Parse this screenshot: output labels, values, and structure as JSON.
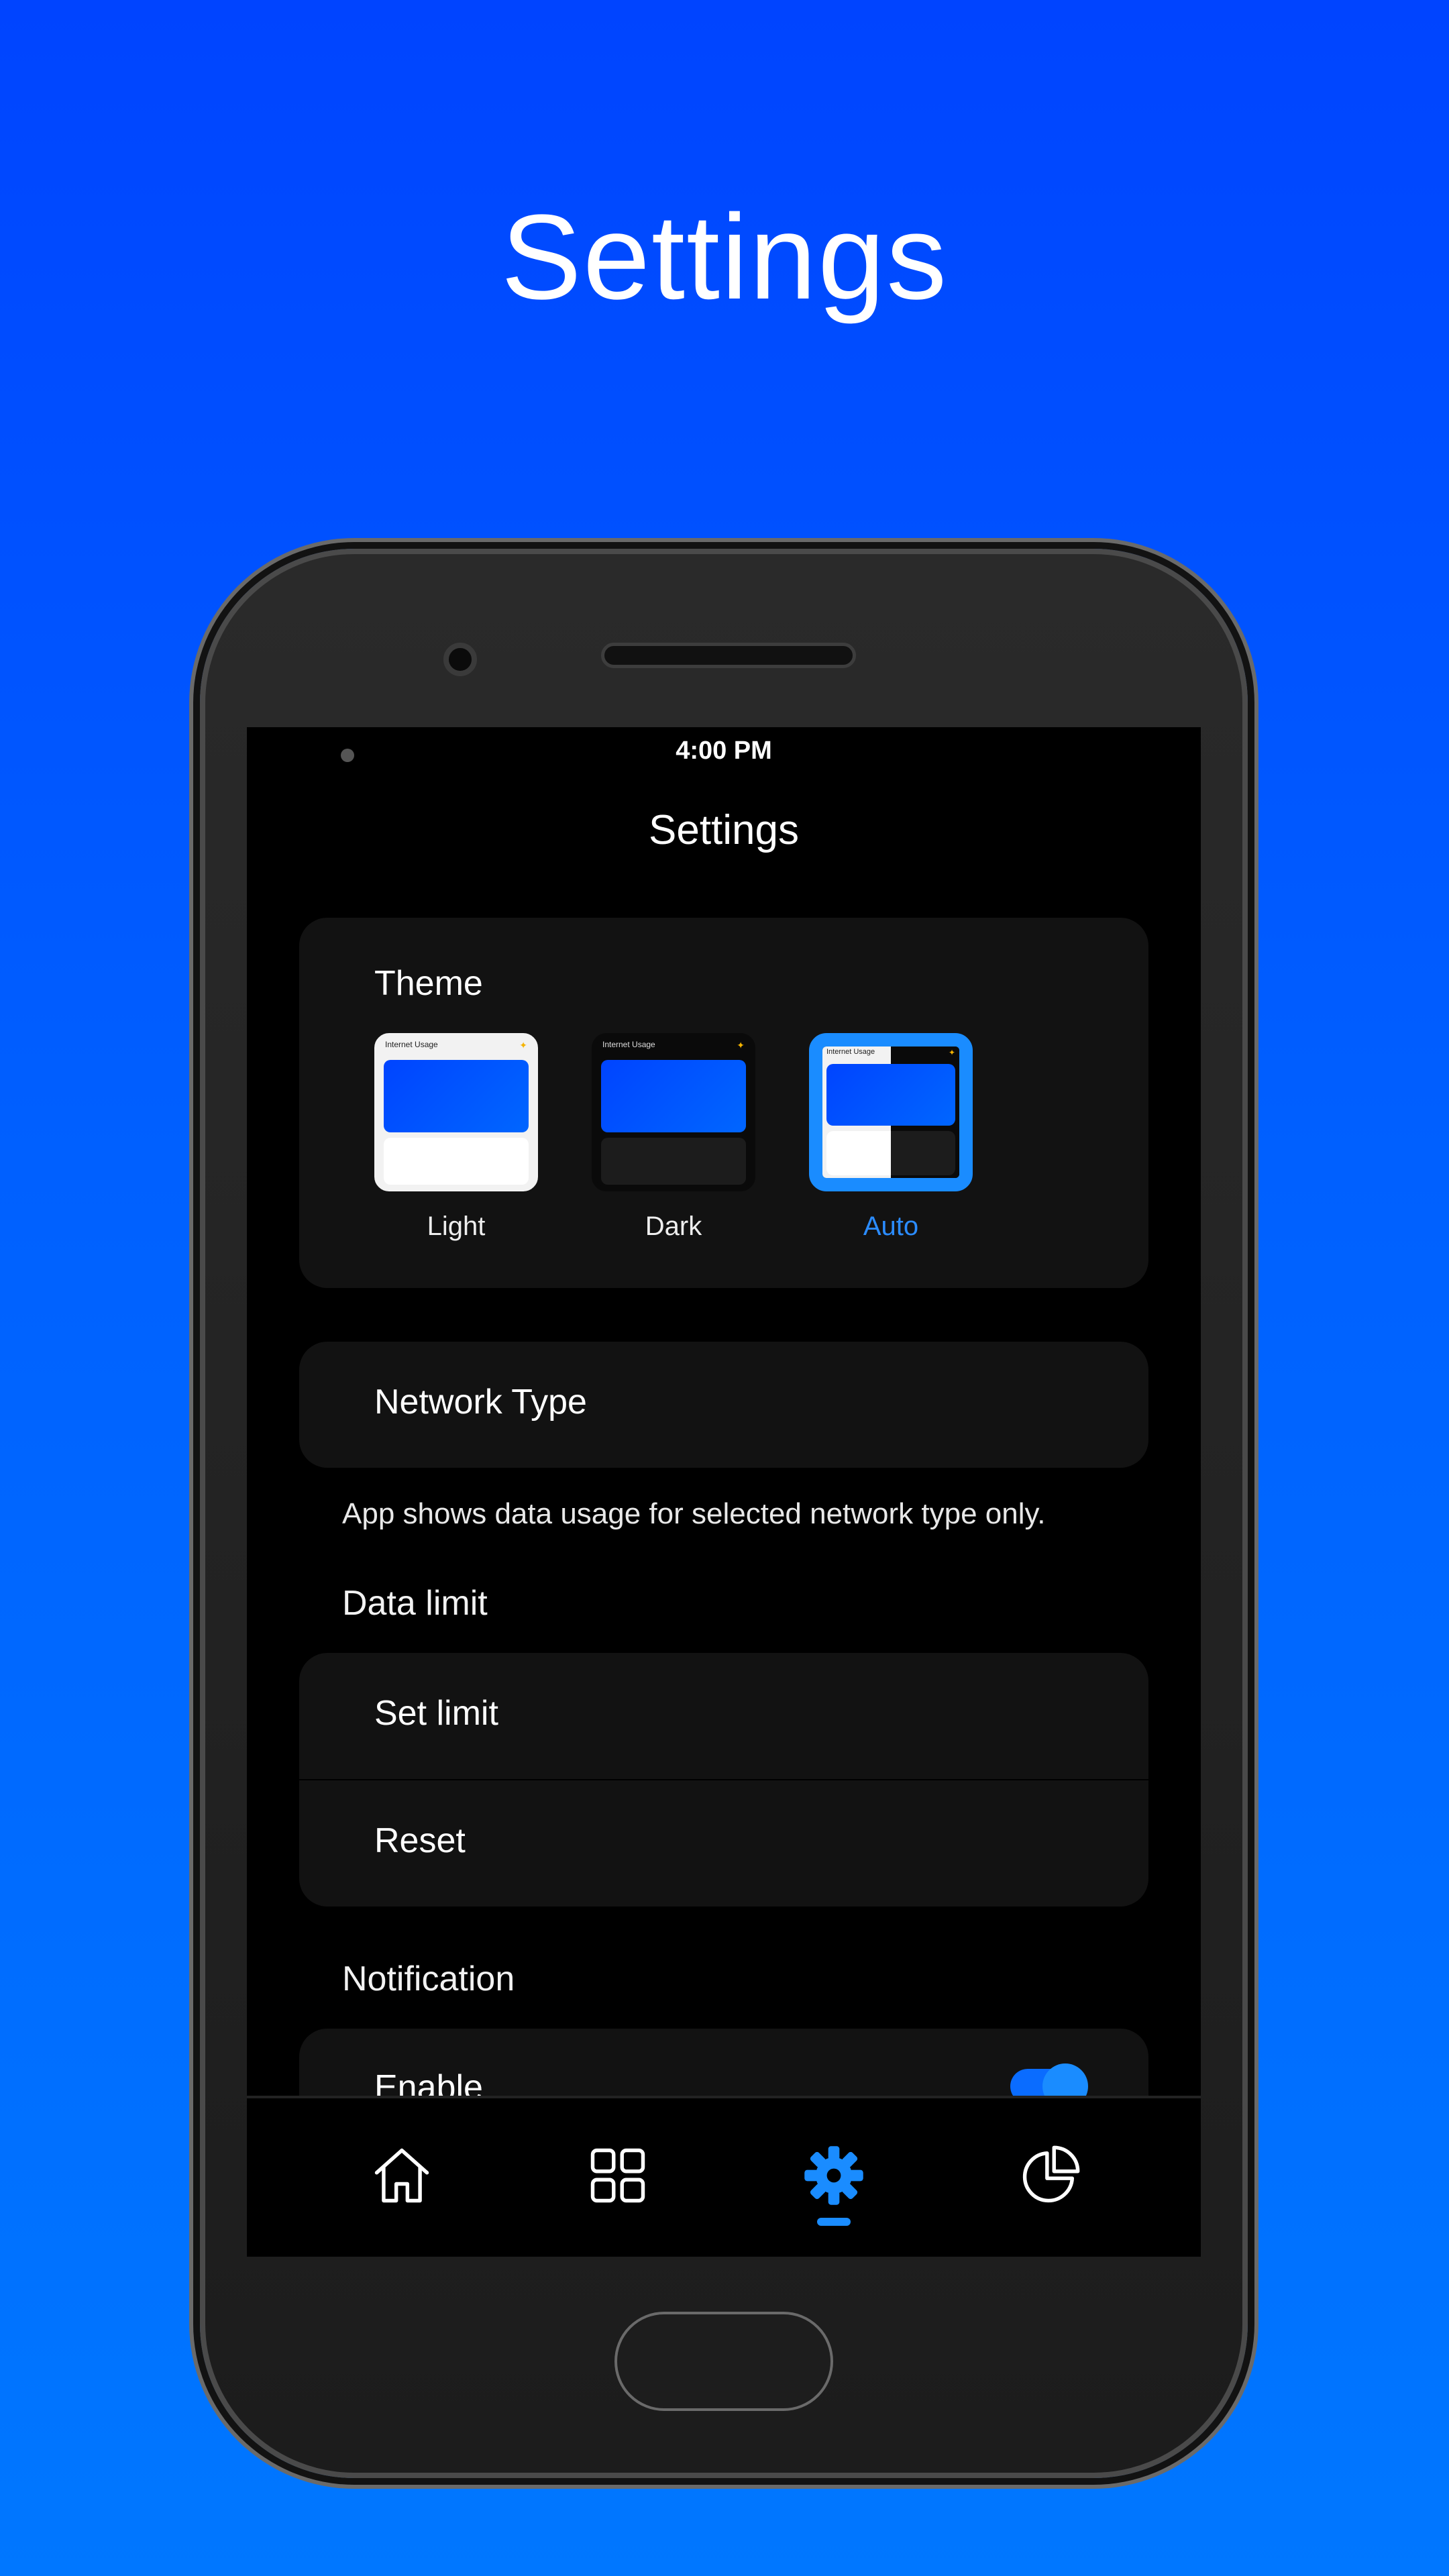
{
  "hero": {
    "title": "Settings"
  },
  "status_bar": {
    "time": "4:00 PM"
  },
  "screen": {
    "title": "Settings"
  },
  "theme": {
    "label": "Theme",
    "thumbnail_header": "Internet Usage",
    "options": [
      {
        "label": "Light",
        "selected": false
      },
      {
        "label": "Dark",
        "selected": false
      },
      {
        "label": "Auto",
        "selected": true
      }
    ]
  },
  "network": {
    "label": "Network Type",
    "helper": "App shows data usage for selected network type only."
  },
  "data_limit": {
    "heading": "Data limit",
    "set_limit": "Set limit",
    "reset": "Reset"
  },
  "notification": {
    "heading": "Notification",
    "enable": "Enable",
    "enabled": true
  },
  "bottom_nav": {
    "items": [
      {
        "icon": "home-icon",
        "active": false
      },
      {
        "icon": "grid-icon",
        "active": false
      },
      {
        "icon": "gear-icon",
        "active": true
      },
      {
        "icon": "pie-chart-icon",
        "active": false
      }
    ]
  },
  "colors": {
    "accent": "#1a8cff",
    "background_top": "#0044ff",
    "background_bottom": "#0077ff",
    "card": "#121212"
  }
}
